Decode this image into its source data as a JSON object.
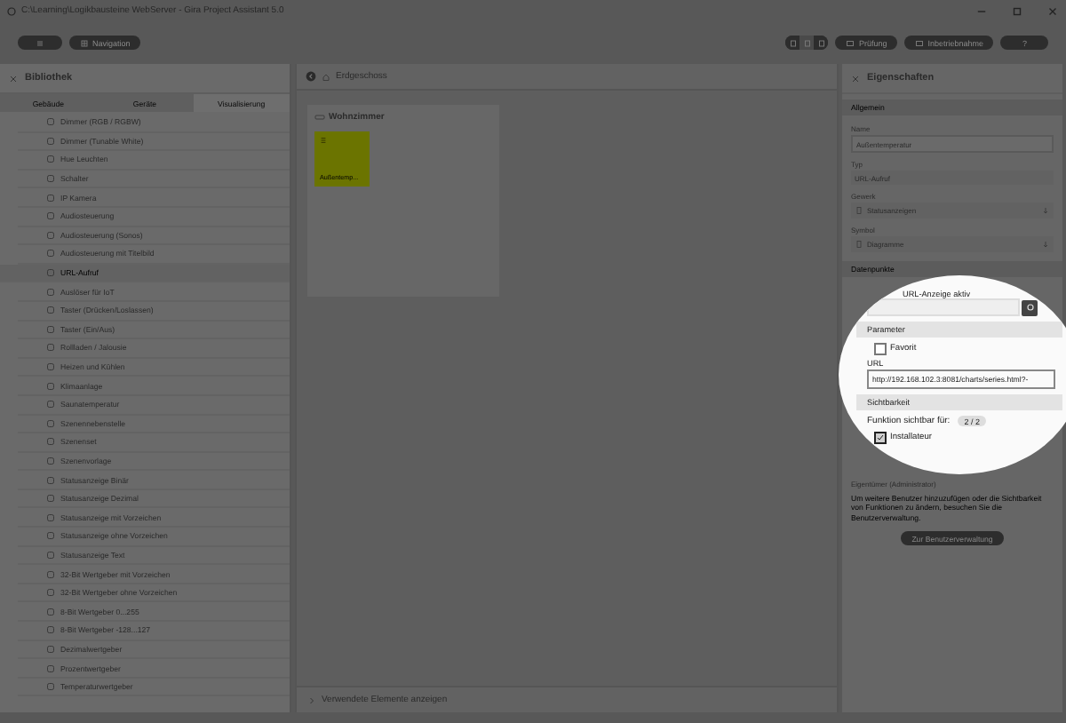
{
  "window": {
    "title": "C:\\Learning\\Logikbausteine WebServer - Gira Project Assistant 5.0"
  },
  "toolbar": {
    "navigation": "Navigation",
    "view_modes": [
      {
        "selected": false
      },
      {
        "selected": true
      },
      {
        "selected": false
      }
    ],
    "buttons": [
      "Prüfung",
      "Inbetriebnahme",
      "?"
    ]
  },
  "library": {
    "title": "Bibliothek",
    "tabs": [
      {
        "label": "Gebäude",
        "selected": false
      },
      {
        "label": "Geräte",
        "selected": false
      },
      {
        "label": "Visualisierung",
        "selected": true
      }
    ],
    "items": [
      {
        "label": "Dimmer (RGB / RGBW)",
        "selected": false
      },
      {
        "label": "Dimmer (Tunable White)",
        "selected": false
      },
      {
        "label": "Hue Leuchten",
        "selected": false
      },
      {
        "label": "Schalter",
        "selected": false
      },
      {
        "label": "IP Kamera",
        "selected": false
      },
      {
        "label": "Audiosteuerung",
        "selected": false
      },
      {
        "label": "Audiosteuerung (Sonos)",
        "selected": false
      },
      {
        "label": "Audiosteuerung mit Titelbild",
        "selected": false
      },
      {
        "label": "URL-Aufruf",
        "selected": true
      },
      {
        "label": "Auslöser für IoT",
        "selected": false
      },
      {
        "label": "Taster (Drücken/Loslassen)",
        "selected": false
      },
      {
        "label": "Taster (Ein/Aus)",
        "selected": false
      },
      {
        "label": "Rollladen / Jalousie",
        "selected": false
      },
      {
        "label": "Heizen und Kühlen",
        "selected": false
      },
      {
        "label": "Klimaanlage",
        "selected": false
      },
      {
        "label": "Saunatemperatur",
        "selected": false
      },
      {
        "label": "Szenennebenstelle",
        "selected": false
      },
      {
        "label": "Szenenset",
        "selected": false
      },
      {
        "label": "Szenenvorlage",
        "selected": false
      },
      {
        "label": "Statusanzeige Binär",
        "selected": false
      },
      {
        "label": "Statusanzeige Dezimal",
        "selected": false
      },
      {
        "label": "Statusanzeige mit Vorzeichen",
        "selected": false
      },
      {
        "label": "Statusanzeige ohne Vorzeichen",
        "selected": false
      },
      {
        "label": "Statusanzeige Text",
        "selected": false
      },
      {
        "label": "32-Bit Wertgeber mit Vorzeichen",
        "selected": false
      },
      {
        "label": "32-Bit Wertgeber ohne Vorzeichen",
        "selected": false
      },
      {
        "label": "8-Bit Wertgeber 0...255",
        "selected": false
      },
      {
        "label": "8-Bit Wertgeber -128...127",
        "selected": false
      },
      {
        "label": "Dezimalwertgeber",
        "selected": false
      },
      {
        "label": "Prozentwertgeber",
        "selected": false
      },
      {
        "label": "Temperaturwertgeber",
        "selected": false
      }
    ]
  },
  "canvas": {
    "floor": "Erdgeschoss",
    "room": {
      "title": "Wohnzimmer",
      "tiles": [
        {
          "label": "Außentemp..."
        }
      ]
    },
    "footer": "Verwendete Elemente anzeigen"
  },
  "properties": {
    "title": "Eigenschaften",
    "general": {
      "header": "Allgemein",
      "fields": [
        {
          "kind": "input",
          "label": "Name",
          "value": "Außentemperatur"
        },
        {
          "kind": "readonly",
          "label": "Typ",
          "value": "URL-Aufruf"
        },
        {
          "kind": "select",
          "label": "Gewerk",
          "value": "Statusanzeigen"
        },
        {
          "kind": "select",
          "label": "Symbol",
          "value": "Diagramme"
        }
      ]
    },
    "datapoints": {
      "header": "Datenpunkte",
      "url_display": "URL-Anzeige aktiv"
    },
    "parameter": {
      "header": "Parameter",
      "favorite": {
        "label": "Favorit",
        "checked": false
      },
      "url_label": "URL",
      "url_value": "http://192.168.102.3:8081/charts/series.html?-"
    },
    "visibility": {
      "header": "Sichtbarkeit",
      "label": "Funktion sichtbar für:",
      "badge": "2 / 2",
      "roles": [
        {
          "label": "Installateur",
          "checked": true
        }
      ],
      "owner": "Eigentümer (Administrator)",
      "note": "Um weitere Benutzer hinzuzufügen oder die Sichtbarkeit von Funktionen zu ändern, besuchen Sie die Benutzerverwaltung.",
      "button": "Zur Benutzerverwaltung"
    }
  }
}
